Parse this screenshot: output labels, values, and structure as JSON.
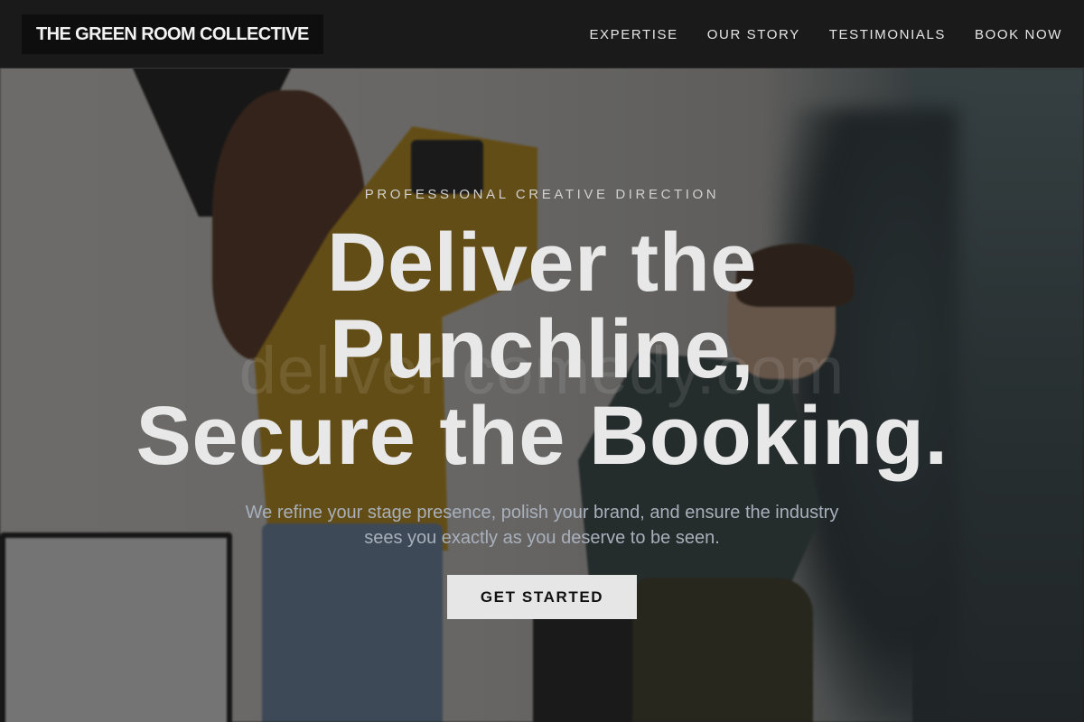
{
  "navbar": {
    "logo": "THE GREEN ROOM COLLECTIVE",
    "links": [
      "EXPERTISE",
      "OUR STORY",
      "TESTIMONIALS",
      "BOOK NOW"
    ]
  },
  "hero": {
    "eyebrow": "PROFESSIONAL CREATIVE DIRECTION",
    "headline_lines": [
      "Deliver the",
      "Punchline,",
      "Secure the Booking."
    ],
    "subtext": "We refine your stage presence, polish your brand, and ensure the industry sees you exactly as you deserve to be seen.",
    "cta_label": "GET STARTED",
    "watermark": "deliver comedy.com"
  },
  "colors": {
    "navbar_bg": "#1a1a1a",
    "logo_bg": "#0e0e0e",
    "headline": "#e8e8e8",
    "subtext": "#a8b0bb",
    "cta_bg": "#e6e6e6",
    "cta_text": "#111111"
  }
}
